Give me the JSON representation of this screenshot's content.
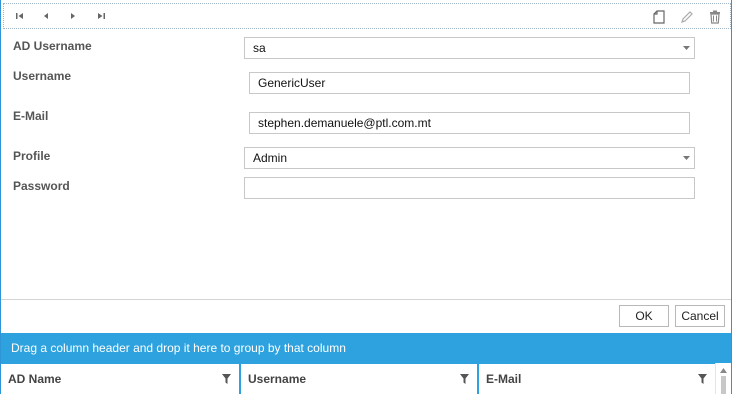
{
  "toolbar": {
    "nav": [
      {
        "name": "first-record-button",
        "icon": "first-icon"
      },
      {
        "name": "previous-record-button",
        "icon": "previous-icon"
      },
      {
        "name": "next-record-button",
        "icon": "next-icon"
      },
      {
        "name": "last-record-button",
        "icon": "last-icon"
      }
    ],
    "actions": [
      {
        "name": "new-record-button",
        "icon": "new-document-icon"
      },
      {
        "name": "edit-record-button",
        "icon": "pencil-icon"
      },
      {
        "name": "delete-record-button",
        "icon": "trash-icon"
      }
    ]
  },
  "form": {
    "ad_username": {
      "label": "AD Username",
      "value": "sa"
    },
    "username": {
      "label": "Username",
      "value": "GenericUser"
    },
    "email": {
      "label": "E-Mail",
      "value": "stephen.demanuele@ptl.com.mt"
    },
    "profile": {
      "label": "Profile",
      "value": "Admin"
    },
    "password": {
      "label": "Password",
      "value": ""
    }
  },
  "buttons": {
    "ok": "OK",
    "cancel": "Cancel"
  },
  "grid": {
    "group_panel_text": "Drag a column header and drop it here to group by that column",
    "columns": [
      "AD Name",
      "Username",
      "E-Mail"
    ]
  },
  "colors": {
    "accent": "#2ea2de",
    "border": "#2f95d6"
  }
}
